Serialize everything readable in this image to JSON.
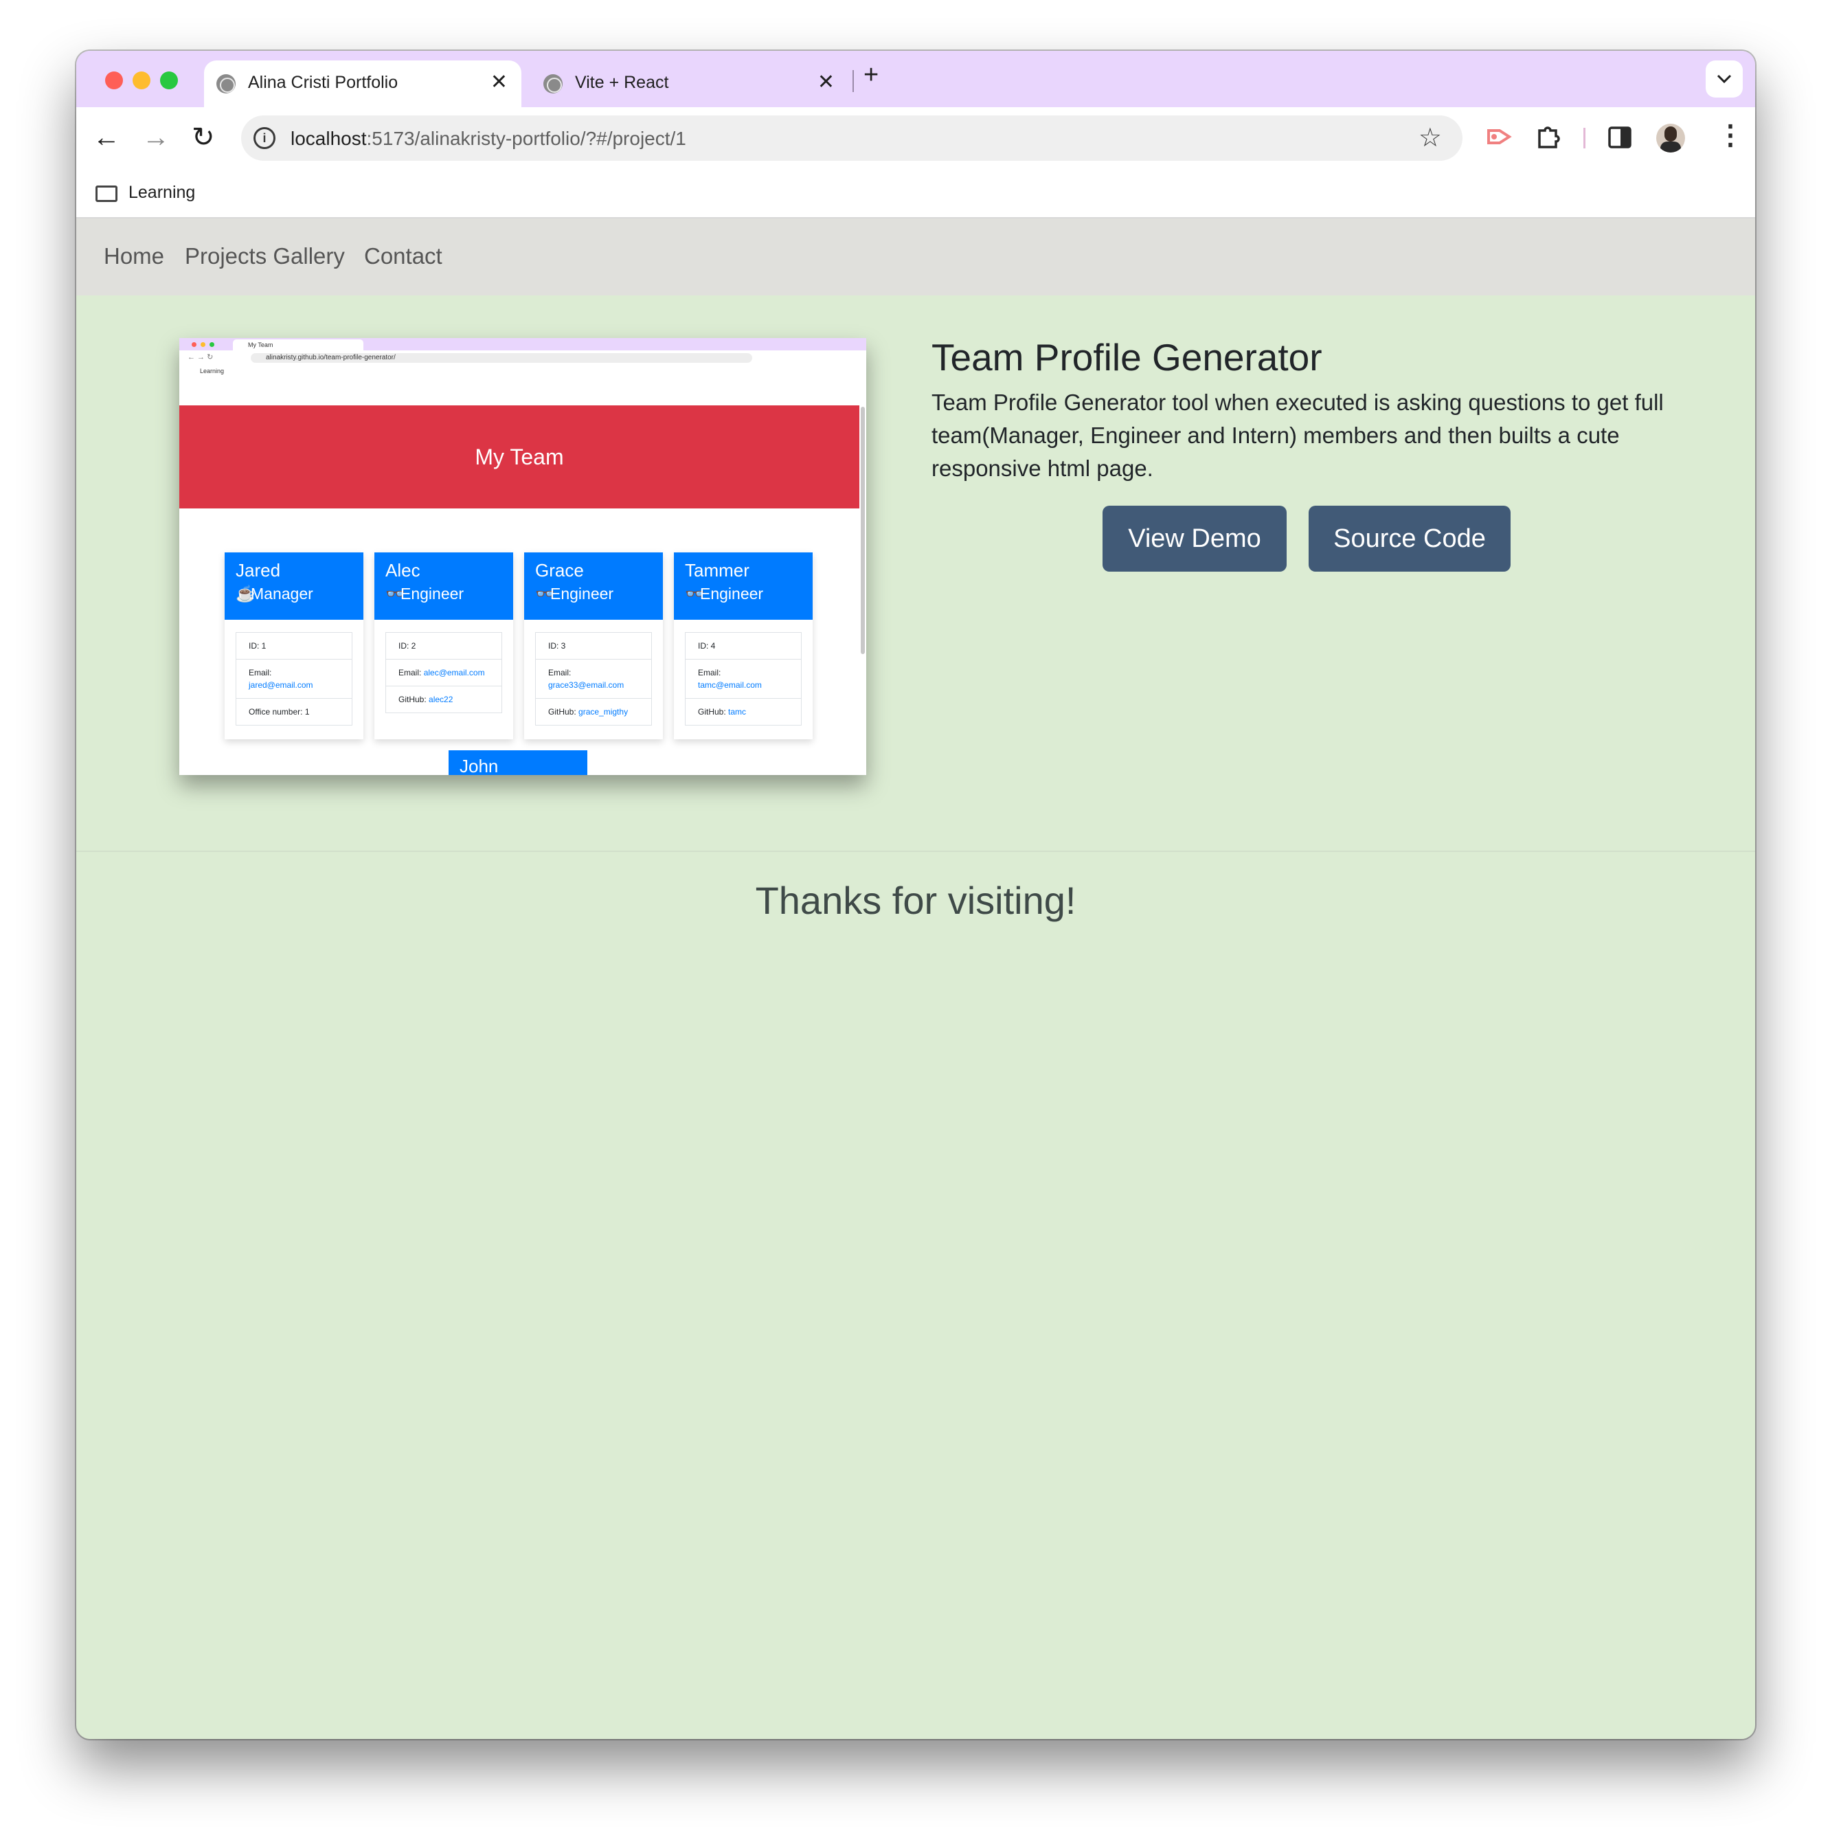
{
  "browser": {
    "tabs": [
      {
        "title": "Alina Cristi Portfolio",
        "close": "✕"
      },
      {
        "title": "Vite + React",
        "close": "✕"
      }
    ],
    "new_tab": "+",
    "url_host": "localhost",
    "url_path": ":5173/alinakristy-portfolio/?#/project/1",
    "bookmark": "Learning",
    "colors": {
      "tabbar": "#e9d6fd",
      "close": "#fe5f57",
      "minimize": "#febc2e",
      "zoom": "#28c840"
    }
  },
  "nav": {
    "home": "Home",
    "gallery": "Projects Gallery",
    "contact": "Contact"
  },
  "project": {
    "title": "Team Profile Generator",
    "description": "Team Profile Generator tool when executed is asking questions to get full team(Manager, Engineer and Intern) members and then builts a cute responsive html page.",
    "demo_button": "View Demo",
    "source_button": "Source Code"
  },
  "screenshot": {
    "tab_title": "My Team",
    "url": "alinakristy.github.io/team-profile-generator/",
    "bookmark": "Learning",
    "hero": "My Team",
    "cards": [
      {
        "name": "Jared",
        "role": "Manager",
        "role_icon": "mug-icon",
        "id": "ID: 1",
        "email_label": "Email:",
        "email": "jared@email.com",
        "extra_label": "Office number: 1",
        "extra_link": ""
      },
      {
        "name": "Alec",
        "role": "Engineer",
        "role_icon": "glasses-icon",
        "id": "ID: 2",
        "email_label": "Email:",
        "email": "alec@email.com",
        "extra_label": "GitHub:",
        "extra_link": "alec22"
      },
      {
        "name": "Grace",
        "role": "Engineer",
        "role_icon": "glasses-icon",
        "id": "ID: 3",
        "email_label": "Email:",
        "email": "grace33@email.com",
        "extra_label": "GitHub:",
        "extra_link": "grace_migthy"
      },
      {
        "name": "Tammer",
        "role": "Engineer",
        "role_icon": "glasses-icon",
        "id": "ID: 4",
        "email_label": "Email:",
        "email": "tamc@email.com",
        "extra_label": "GitHub:",
        "extra_link": "tamc"
      }
    ],
    "partial_card": "John"
  },
  "footer": {
    "thanks": "Thanks for visiting!"
  }
}
